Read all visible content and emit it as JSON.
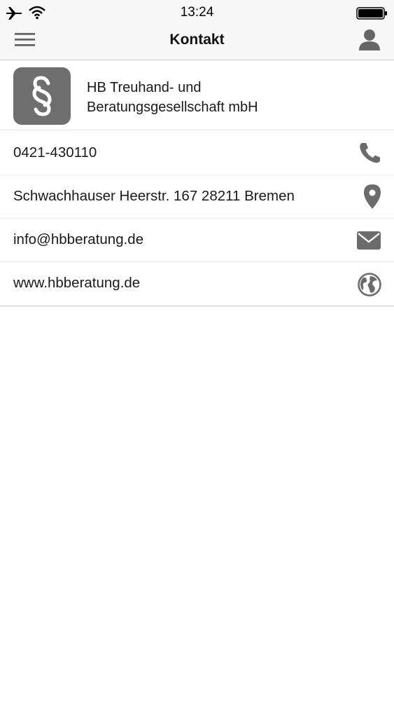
{
  "status_bar": {
    "time": "13:24",
    "icons": [
      "airplane-icon",
      "wifi-icon",
      "battery-icon"
    ]
  },
  "nav": {
    "title": "Kontakt",
    "left_icon": "menu-icon",
    "right_icon": "profile-icon"
  },
  "company": {
    "name_line1": "HB Treuhand- und",
    "name_line2": "Beratungsgesellschaft mbH",
    "logo_icon": "paragraph-icon",
    "logo_color": "#6e6e6e"
  },
  "contacts": [
    {
      "label": "0421-430110",
      "icon": "phone-icon"
    },
    {
      "label": "Schwachhauser Heerstr. 167 28211 Bremen",
      "icon": "location-pin-icon"
    },
    {
      "label": "info@hbberatung.de",
      "icon": "mail-icon"
    },
    {
      "label": "www.hbberatung.de",
      "icon": "globe-icon"
    }
  ],
  "colors": {
    "icon_gray": "#6b6b6b",
    "topbar_bg": "#f7f7f7"
  }
}
